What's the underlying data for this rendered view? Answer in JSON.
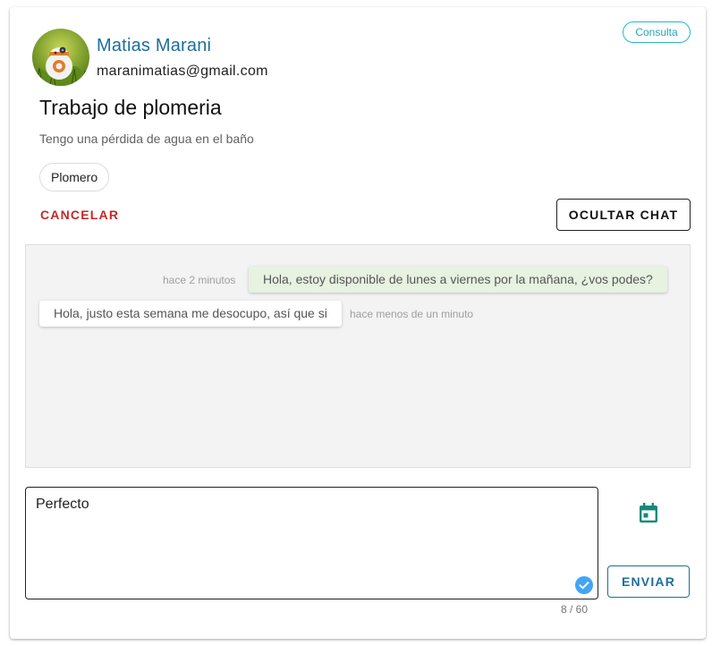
{
  "request": {
    "type_badge": "Consulta",
    "user": {
      "name": "Matias Marani",
      "email": "maranimatias@gmail.com",
      "avatar_icon": "robot-avatar-icon"
    },
    "title": "Trabajo de plomeria",
    "description": "Tengo una pérdida de agua en el baño",
    "category_chip": "Plomero"
  },
  "actions": {
    "cancel_label": "CANCELAR",
    "hide_chat_label": "OCULTAR CHAT"
  },
  "chat": {
    "messages": [
      {
        "direction": "outgoing",
        "text": "Hola, estoy disponible de lunes a viernes por la mañana, ¿vos podes?",
        "time": "hace 2 minutos"
      },
      {
        "direction": "incoming",
        "text": "Hola, justo esta semana me desocupo, así que si",
        "time": "hace menos de un minuto"
      }
    ]
  },
  "composer": {
    "value": "Perfecto",
    "counter": "8 / 60",
    "send_label": "ENVIAR",
    "calendar_icon": "calendar-icon",
    "valid_icon": "check-circle-icon"
  },
  "colors": {
    "accent": "#1a6e9e",
    "badge": "#26b5c9",
    "danger": "#c62828",
    "outgoing_bubble": "#e7f2e1",
    "calendar": "#12897a",
    "check": "#42a5f5"
  }
}
